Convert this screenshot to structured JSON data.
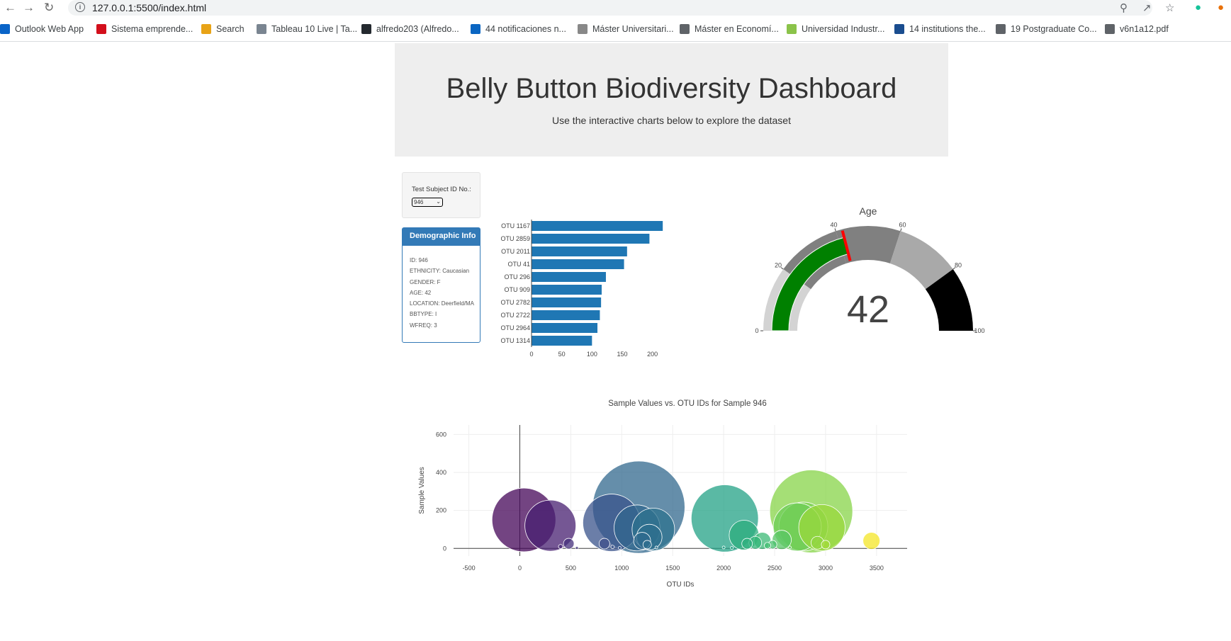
{
  "browser": {
    "url": "127.0.0.1:5500/index.html",
    "bookmarks": [
      {
        "label": "Outlook Web App",
        "color": "#0a64c8"
      },
      {
        "label": "Sistema emprende...",
        "color": "#d30f1c"
      },
      {
        "label": "Search",
        "color": "#e8a317"
      },
      {
        "label": "Tableau 10 Live | Ta...",
        "color": "#7a8591"
      },
      {
        "label": "alfredo203 (Alfredo...",
        "color": "#24292f"
      },
      {
        "label": "44 notificaciones n...",
        "color": "#0a66c2"
      },
      {
        "label": "Máster Universitari...",
        "color": "#888888"
      },
      {
        "label": "Máster en Economí...",
        "color": "#5f6368"
      },
      {
        "label": "Universidad Industr...",
        "color": "#8bc34a"
      },
      {
        "label": "14 institutions the...",
        "color": "#1a4d8f"
      },
      {
        "label": "19 Postgraduate Co...",
        "color": "#5f6368"
      },
      {
        "label": "v6n1a12.pdf",
        "color": "#5f6368"
      }
    ]
  },
  "header": {
    "title": "Belly Button Biodiversity Dashboard",
    "subtitle": "Use the interactive charts below to explore the dataset"
  },
  "selector": {
    "label": "Test Subject ID No.:",
    "value": "946"
  },
  "demographic": {
    "title": "Demographic Info",
    "lines": [
      "ID: 946",
      "ETHNICITY: Caucasian",
      "GENDER: F",
      "AGE: 42",
      "LOCATION: Deerfield/MA",
      "BBTYPE: I",
      "WFREQ: 3"
    ]
  },
  "colors": {
    "bar": "#1f77b4",
    "panel": "#337ab7",
    "gauge_bar": "green",
    "gauge_threshold": "red"
  },
  "chart_data": [
    {
      "type": "bar",
      "orientation": "horizontal",
      "categories": [
        "OTU 1167",
        "OTU 2859",
        "OTU 2011",
        "OTU 41",
        "OTU 296",
        "OTU 909",
        "OTU 2782",
        "OTU 2722",
        "OTU 2964",
        "OTU 1314"
      ],
      "values": [
        217,
        195,
        158,
        153,
        123,
        116,
        115,
        113,
        109,
        100
      ],
      "xticks": [
        0,
        50,
        100,
        150,
        200
      ],
      "xlim": [
        0,
        225
      ]
    },
    {
      "type": "gauge",
      "title": "Age",
      "value": 42,
      "range": [
        0,
        100
      ],
      "ticks": [
        0,
        20,
        40,
        60,
        80,
        100
      ],
      "threshold": 42,
      "steps": [
        {
          "range": [
            0,
            20
          ],
          "color": "#d3d3d3"
        },
        {
          "range": [
            20,
            40
          ],
          "color": "#808080"
        },
        {
          "range": [
            40,
            60
          ],
          "color": "#808080"
        },
        {
          "range": [
            60,
            80
          ],
          "color": "#a9a9a9"
        },
        {
          "range": [
            80,
            100
          ],
          "color": "#000000"
        }
      ]
    },
    {
      "type": "scatter",
      "title": "Sample Values vs. OTU IDs for Sample 946",
      "xlabel": "OTU IDs",
      "ylabel": "Sample Values",
      "xlim": [
        -650,
        3800
      ],
      "ylim": [
        -40,
        650
      ],
      "xticks": [
        -500,
        0,
        500,
        1000,
        1500,
        2000,
        2500,
        3000,
        3500
      ],
      "yticks": [
        0,
        200,
        400,
        600
      ],
      "colorscale": "Viridis",
      "points": [
        {
          "x": 40,
          "y": 150
        },
        {
          "x": 300,
          "y": 120
        },
        {
          "x": 400,
          "y": 10
        },
        {
          "x": 480,
          "y": 25
        },
        {
          "x": 560,
          "y": 3
        },
        {
          "x": 900,
          "y": 135
        },
        {
          "x": 830,
          "y": 25
        },
        {
          "x": 910,
          "y": 8
        },
        {
          "x": 980,
          "y": 3
        },
        {
          "x": 1167,
          "y": 217
        },
        {
          "x": 1150,
          "y": 108
        },
        {
          "x": 1310,
          "y": 100
        },
        {
          "x": 1270,
          "y": 60
        },
        {
          "x": 1200,
          "y": 40
        },
        {
          "x": 1250,
          "y": 20
        },
        {
          "x": 1340,
          "y": 5
        },
        {
          "x": 2011,
          "y": 158
        },
        {
          "x": 2000,
          "y": 5
        },
        {
          "x": 2080,
          "y": 3
        },
        {
          "x": 2200,
          "y": 70
        },
        {
          "x": 2230,
          "y": 25
        },
        {
          "x": 2310,
          "y": 30
        },
        {
          "x": 2380,
          "y": 40
        },
        {
          "x": 2430,
          "y": 15
        },
        {
          "x": 2480,
          "y": 20
        },
        {
          "x": 2570,
          "y": 45
        },
        {
          "x": 2650,
          "y": 5
        },
        {
          "x": 2722,
          "y": 113
        },
        {
          "x": 2782,
          "y": 115
        },
        {
          "x": 2859,
          "y": 195
        },
        {
          "x": 2964,
          "y": 109
        },
        {
          "x": 2920,
          "y": 30
        },
        {
          "x": 3000,
          "y": 20
        },
        {
          "x": 3450,
          "y": 40
        }
      ]
    }
  ]
}
